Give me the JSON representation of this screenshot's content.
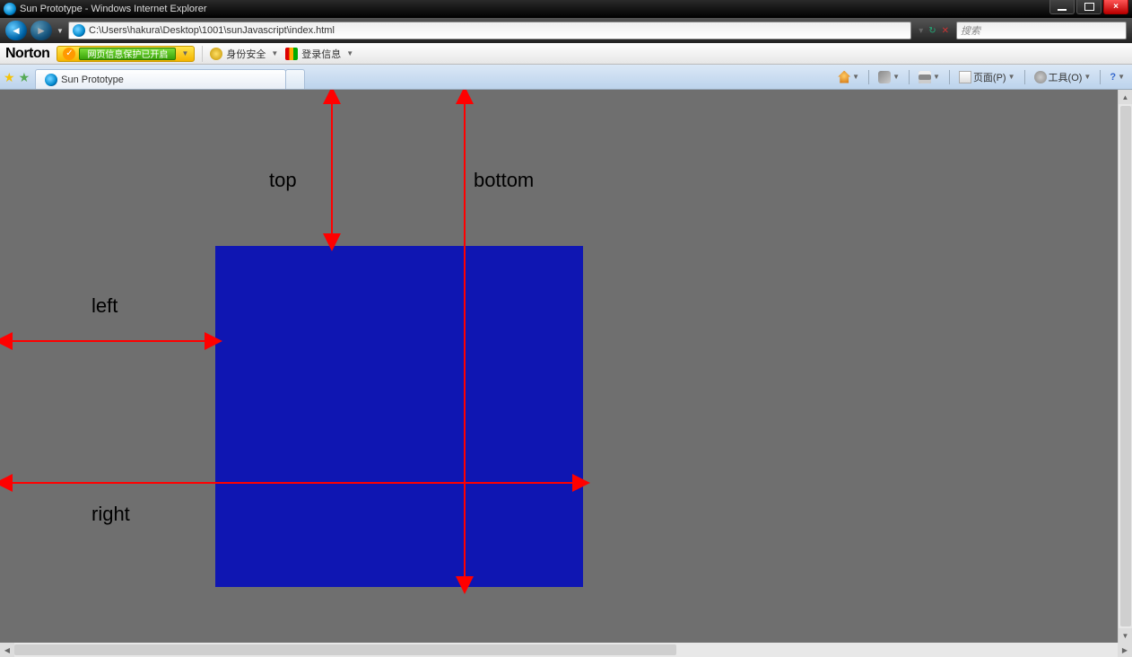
{
  "window": {
    "title": "Sun Prototype - Windows Internet Explorer"
  },
  "nav": {
    "address": "C:\\Users\\hakura\\Desktop\\1001\\sunJavascript\\index.html",
    "search_placeholder": "搜索"
  },
  "norton": {
    "logo": "Norton",
    "badge_text": "网页信息保护已开启",
    "item_identity": "身份安全",
    "item_login": "登录信息"
  },
  "tabs": {
    "active_title": "Sun Prototype"
  },
  "commandbar": {
    "page": "页面(P)",
    "tools": "工具(O)"
  },
  "diagram": {
    "top": "top",
    "bottom": "bottom",
    "left": "left",
    "right": "right"
  }
}
